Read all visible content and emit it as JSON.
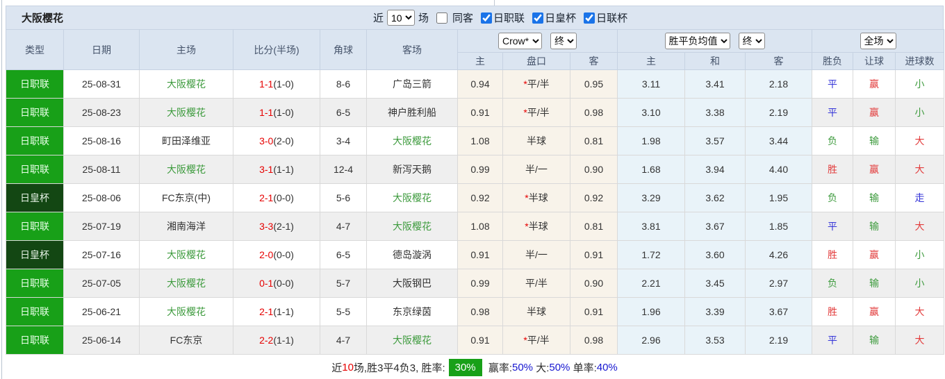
{
  "title": "大阪樱花",
  "toolbar": {
    "recent_label": "近",
    "recent_value": "10",
    "games_label": "场",
    "same_away_label": "同客",
    "leagues": [
      {
        "label": "日职联",
        "checked": true
      },
      {
        "label": "日皇杯",
        "checked": true
      },
      {
        "label": "日联杯",
        "checked": true
      }
    ]
  },
  "header": {
    "col_type": "类型",
    "col_date": "日期",
    "col_home": "主场",
    "col_score": "比分(半场)",
    "col_corner": "角球",
    "col_away": "客场",
    "odds_source_select": "Crow*",
    "odds_time_select": "终",
    "avg_select": "胜平负均值",
    "avg_time_select": "终",
    "scope_select": "全场",
    "sub_home": "主",
    "sub_handicap": "盘口",
    "sub_away": "客",
    "sub_avg_home": "主",
    "sub_avg_draw": "和",
    "sub_avg_away": "客",
    "col_result": "胜负",
    "col_handicap_result": "让球",
    "col_goals": "进球数"
  },
  "rows": [
    {
      "league": "日职联",
      "league_style": "bright",
      "date": "25-08-31",
      "home": "大阪樱花",
      "home_self": true,
      "score_ft": "1-1",
      "score_ht": "(1-0)",
      "corner": "8-6",
      "away": "广岛三箭",
      "away_self": false,
      "crow_home": "0.94",
      "handicap_star": true,
      "handicap": "平/半",
      "crow_away": "0.95",
      "avg_home": "3.11",
      "avg_draw": "3.41",
      "avg_away": "2.18",
      "result": "平",
      "result_color": "blue",
      "spread": "赢",
      "spread_color": "red",
      "goals": "小",
      "goals_color": "green"
    },
    {
      "league": "日职联",
      "league_style": "bright",
      "date": "25-08-23",
      "home": "大阪樱花",
      "home_self": true,
      "score_ft": "1-1",
      "score_ht": "(1-0)",
      "corner": "6-5",
      "away": "神户胜利船",
      "away_self": false,
      "crow_home": "0.91",
      "handicap_star": true,
      "handicap": "平/半",
      "crow_away": "0.98",
      "avg_home": "3.10",
      "avg_draw": "3.38",
      "avg_away": "2.19",
      "result": "平",
      "result_color": "blue",
      "spread": "赢",
      "spread_color": "red",
      "goals": "小",
      "goals_color": "green"
    },
    {
      "league": "日职联",
      "league_style": "bright",
      "date": "25-08-16",
      "home": "町田泽维亚",
      "home_self": false,
      "score_ft": "3-0",
      "score_ht": "(2-0)",
      "corner": "3-4",
      "away": "大阪樱花",
      "away_self": true,
      "crow_home": "1.08",
      "handicap_star": false,
      "handicap": "半球",
      "crow_away": "0.81",
      "avg_home": "1.98",
      "avg_draw": "3.57",
      "avg_away": "3.44",
      "result": "负",
      "result_color": "green",
      "spread": "输",
      "spread_color": "green",
      "goals": "大",
      "goals_color": "red"
    },
    {
      "league": "日职联",
      "league_style": "bright",
      "date": "25-08-11",
      "home": "大阪樱花",
      "home_self": true,
      "score_ft": "3-1",
      "score_ht": "(1-1)",
      "corner": "12-4",
      "away": "新泻天鹅",
      "away_self": false,
      "crow_home": "0.99",
      "handicap_star": false,
      "handicap": "半/一",
      "crow_away": "0.90",
      "avg_home": "1.68",
      "avg_draw": "3.94",
      "avg_away": "4.40",
      "result": "胜",
      "result_color": "red",
      "spread": "赢",
      "spread_color": "red",
      "goals": "大",
      "goals_color": "red"
    },
    {
      "league": "日皇杯",
      "league_style": "dark",
      "date": "25-08-06",
      "home": "FC东京(中)",
      "home_self": false,
      "score_ft": "2-1",
      "score_ht": "(0-0)",
      "corner": "5-6",
      "away": "大阪樱花",
      "away_self": true,
      "crow_home": "0.92",
      "handicap_star": true,
      "handicap": "半球",
      "crow_away": "0.92",
      "avg_home": "3.29",
      "avg_draw": "3.62",
      "avg_away": "1.95",
      "result": "负",
      "result_color": "green",
      "spread": "输",
      "spread_color": "green",
      "goals": "走",
      "goals_color": "blue"
    },
    {
      "league": "日职联",
      "league_style": "bright",
      "date": "25-07-19",
      "home": "湘南海洋",
      "home_self": false,
      "score_ft": "3-3",
      "score_ht": "(2-1)",
      "corner": "4-7",
      "away": "大阪樱花",
      "away_self": true,
      "crow_home": "1.08",
      "handicap_star": true,
      "handicap": "半球",
      "crow_away": "0.81",
      "avg_home": "3.81",
      "avg_draw": "3.67",
      "avg_away": "1.85",
      "result": "平",
      "result_color": "blue",
      "spread": "输",
      "spread_color": "green",
      "goals": "大",
      "goals_color": "red"
    },
    {
      "league": "日皇杯",
      "league_style": "dark",
      "date": "25-07-16",
      "home": "大阪樱花",
      "home_self": true,
      "score_ft": "2-0",
      "score_ht": "(0-0)",
      "corner": "6-5",
      "away": "德岛漩涡",
      "away_self": false,
      "crow_home": "0.91",
      "handicap_star": false,
      "handicap": "半/一",
      "crow_away": "0.91",
      "avg_home": "1.72",
      "avg_draw": "3.60",
      "avg_away": "4.26",
      "result": "胜",
      "result_color": "red",
      "spread": "赢",
      "spread_color": "red",
      "goals": "小",
      "goals_color": "green"
    },
    {
      "league": "日职联",
      "league_style": "bright",
      "date": "25-07-05",
      "home": "大阪樱花",
      "home_self": true,
      "score_ft": "0-1",
      "score_ht": "(0-0)",
      "corner": "5-7",
      "away": "大阪钢巴",
      "away_self": false,
      "crow_home": "0.99",
      "handicap_star": false,
      "handicap": "平/半",
      "crow_away": "0.90",
      "avg_home": "2.21",
      "avg_draw": "3.45",
      "avg_away": "2.97",
      "result": "负",
      "result_color": "green",
      "spread": "输",
      "spread_color": "green",
      "goals": "小",
      "goals_color": "green"
    },
    {
      "league": "日职联",
      "league_style": "bright",
      "date": "25-06-21",
      "home": "大阪樱花",
      "home_self": true,
      "score_ft": "2-1",
      "score_ht": "(1-1)",
      "corner": "5-5",
      "away": "东京绿茵",
      "away_self": false,
      "crow_home": "0.98",
      "handicap_star": false,
      "handicap": "半球",
      "crow_away": "0.91",
      "avg_home": "1.96",
      "avg_draw": "3.39",
      "avg_away": "3.67",
      "result": "胜",
      "result_color": "red",
      "spread": "赢",
      "spread_color": "red",
      "goals": "大",
      "goals_color": "red"
    },
    {
      "league": "日职联",
      "league_style": "bright",
      "date": "25-06-14",
      "home": "FC东京",
      "home_self": false,
      "score_ft": "2-2",
      "score_ht": "(1-1)",
      "corner": "4-7",
      "away": "大阪樱花",
      "away_self": true,
      "crow_home": "0.91",
      "handicap_star": true,
      "handicap": "平/半",
      "crow_away": "0.98",
      "avg_home": "2.96",
      "avg_draw": "3.53",
      "avg_away": "2.19",
      "result": "平",
      "result_color": "blue",
      "spread": "输",
      "spread_color": "green",
      "goals": "大",
      "goals_color": "red"
    }
  ],
  "footer": {
    "prefix": "近",
    "count": "10",
    "mid": "场,胜3平4负3, 胜率:",
    "rate": "30%",
    "win_label": " 赢率:",
    "win": "50%",
    "big_label": " 大:",
    "big": "50%",
    "single_label": " 单率:",
    "single": "40%"
  },
  "colors": {
    "league_bright_green": "#18a018",
    "league_dark_green": "#134713",
    "self_team_green": "#3e9b3e",
    "score_red": "#e60000",
    "win_red": "#e23b3b",
    "draw_blue": "#3434d8",
    "lose_green": "#3e9b3e",
    "rate_badge_green": "#18a018",
    "pct_blue": "#1515d0",
    "header_bg": "#dbe5f1"
  }
}
